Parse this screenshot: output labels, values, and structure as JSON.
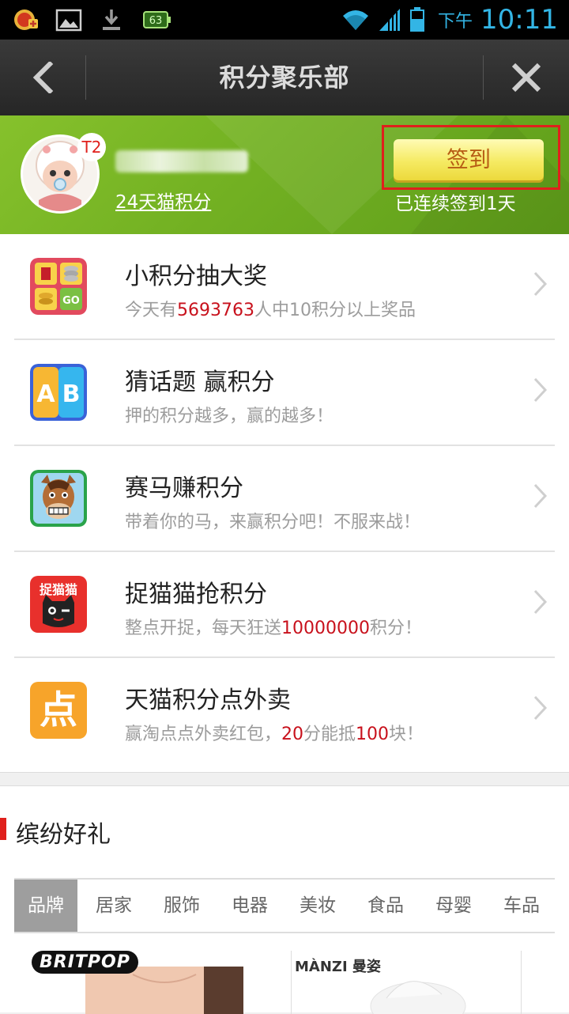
{
  "status_bar": {
    "ampm": "下午",
    "time": "10:11",
    "battery_label": "63",
    "icons": [
      "app-badge-icon",
      "image-icon",
      "download-icon",
      "battery-app-icon",
      "wifi-icon",
      "signal-icon",
      "battery-icon"
    ]
  },
  "titlebar": {
    "title": "积分聚乐部",
    "back_icon": "chevron-left-icon",
    "close_icon": "close-icon"
  },
  "header": {
    "level": "T2",
    "points_link": "24天猫积分",
    "checkin_label": "签到",
    "checkin_status": "已连续签到1天",
    "colors": {
      "accent_green": "#74b223",
      "checkin_text": "#b75d15",
      "highlight_red": "#e0201c"
    }
  },
  "list": [
    {
      "title": "小积分抽大奖",
      "sub_pre": "今天有",
      "sub_hl": "5693763",
      "sub_post": "人中10积分以上奖品",
      "icon": "lottery-icon"
    },
    {
      "title": "猜话题 赢积分",
      "sub_pre": "押的积分越多，赢的越多！",
      "sub_hl": "",
      "sub_post": "",
      "icon": "ab-quiz-icon"
    },
    {
      "title": "赛马赚积分",
      "sub_pre": "带着你的马，来赢积分吧！不服来战！",
      "sub_hl": "",
      "sub_post": "",
      "icon": "horse-icon"
    },
    {
      "title": "捉猫猫抢积分",
      "sub_pre": "整点开捉，每天狂送",
      "sub_hl": "10000000",
      "sub_post": "积分！",
      "icon": "catch-cat-icon",
      "icon_text": "捉猫猫"
    },
    {
      "title": "天猫积分点外卖",
      "sub_pre": "赢淘点点外卖红包，",
      "sub_hl": "20",
      "sub_mid": "分能抵",
      "sub_hl2": "100",
      "sub_post": "块！",
      "icon": "takeout-icon",
      "icon_text": "点"
    }
  ],
  "gifts": {
    "title": "缤纷好礼",
    "tabs": [
      "品牌",
      "居家",
      "服饰",
      "电器",
      "美妆",
      "食品",
      "母婴",
      "车品"
    ],
    "active_tab": "品牌",
    "products": [
      {
        "brand": "BRITPOP"
      },
      {
        "brand": "MÀNZI 曼姿"
      }
    ]
  }
}
